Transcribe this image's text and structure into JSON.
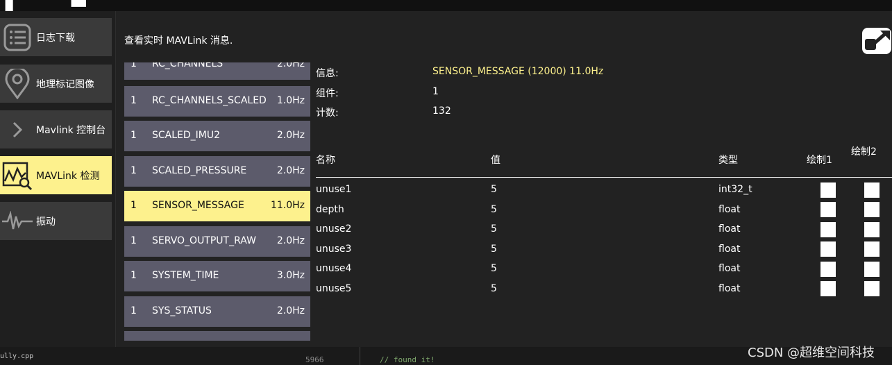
{
  "sidebar": {
    "items": [
      {
        "label": "日志下载",
        "icon": "list-icon"
      },
      {
        "label": "地理标记图像",
        "icon": "map-pin-icon"
      },
      {
        "label": "Mavlink 控制台",
        "icon": "chevron-right-icon"
      },
      {
        "label": "MAVLink 检测",
        "icon": "chart-search-icon",
        "active": true
      },
      {
        "label": "振动",
        "icon": "waveform-icon"
      }
    ]
  },
  "header": {
    "text": "查看实时 MAVLink 消息."
  },
  "messages": [
    {
      "comp": "1",
      "name": "RC_CHANNELS",
      "hz": "2.0Hz"
    },
    {
      "comp": "1",
      "name": "RC_CHANNELS_SCALED",
      "hz": "1.0Hz"
    },
    {
      "comp": "1",
      "name": "SCALED_IMU2",
      "hz": "2.0Hz"
    },
    {
      "comp": "1",
      "name": "SCALED_PRESSURE",
      "hz": "2.0Hz"
    },
    {
      "comp": "1",
      "name": "SENSOR_MESSAGE",
      "hz": "11.0Hz",
      "active": true
    },
    {
      "comp": "1",
      "name": "SERVO_OUTPUT_RAW",
      "hz": "2.0Hz"
    },
    {
      "comp": "1",
      "name": "SYSTEM_TIME",
      "hz": "3.0Hz"
    },
    {
      "comp": "1",
      "name": "SYS_STATUS",
      "hz": "2.0Hz"
    }
  ],
  "details": {
    "info_label": "信息:",
    "info_value": "SENSOR_MESSAGE (12000) 11.0Hz",
    "component_label": "组件:",
    "component_value": "1",
    "count_label": "计数:",
    "count_value": "132"
  },
  "fields_table": {
    "headers": {
      "name": "名称",
      "value": "值",
      "type": "类型",
      "plot1": "绘制1",
      "plot2": "绘制2"
    },
    "rows": [
      {
        "name": "unuse1",
        "value": "5",
        "type": "int32_t"
      },
      {
        "name": "depth",
        "value": "5",
        "type": "float"
      },
      {
        "name": "unuse2",
        "value": "5",
        "type": "float"
      },
      {
        "name": "unuse3",
        "value": "5",
        "type": "float"
      },
      {
        "name": "unuse4",
        "value": "5",
        "type": "float"
      },
      {
        "name": "unuse5",
        "value": "5",
        "type": "float"
      }
    ]
  },
  "editor_strip": {
    "filename": "ully.cpp",
    "line_number": "5966",
    "code": "// found it!"
  },
  "watermark": "CSDN @超维空间科技",
  "colors": {
    "accent": "#fdf18d",
    "list_item": "#5c5b6b",
    "background": "#222222"
  }
}
